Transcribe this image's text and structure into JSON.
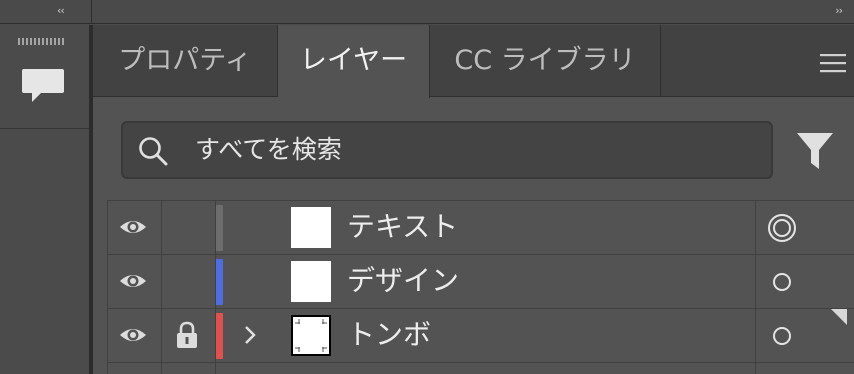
{
  "toolbar": {
    "collapse_left": "‹‹",
    "collapse_right": "››",
    "comment_icon": "speech-bubble-icon"
  },
  "tabs": [
    {
      "label": "プロパティ",
      "active": false
    },
    {
      "label": "レイヤー",
      "active": true
    },
    {
      "label": "CC ライブラリ",
      "active": false
    }
  ],
  "search": {
    "text": "すべてを検索",
    "icon": "search-icon"
  },
  "filter": {
    "icon": "filter-icon"
  },
  "menu": {
    "icon": "hamburger-menu-icon"
  },
  "layers": [
    {
      "name": "テキスト",
      "visible": true,
      "locked": false,
      "color": "#6d6d6d",
      "expandable": false,
      "targeted": true
    },
    {
      "name": "デザイン",
      "visible": true,
      "locked": false,
      "color": "#4d6ee0",
      "expandable": false,
      "targeted": false
    },
    {
      "name": "トンボ",
      "visible": true,
      "locked": true,
      "color": "#e0504d",
      "expandable": true,
      "targeted": false
    }
  ],
  "colors": {
    "panel_bg": "#535353",
    "tab_bar_bg": "#424242",
    "text": "#ededed"
  }
}
